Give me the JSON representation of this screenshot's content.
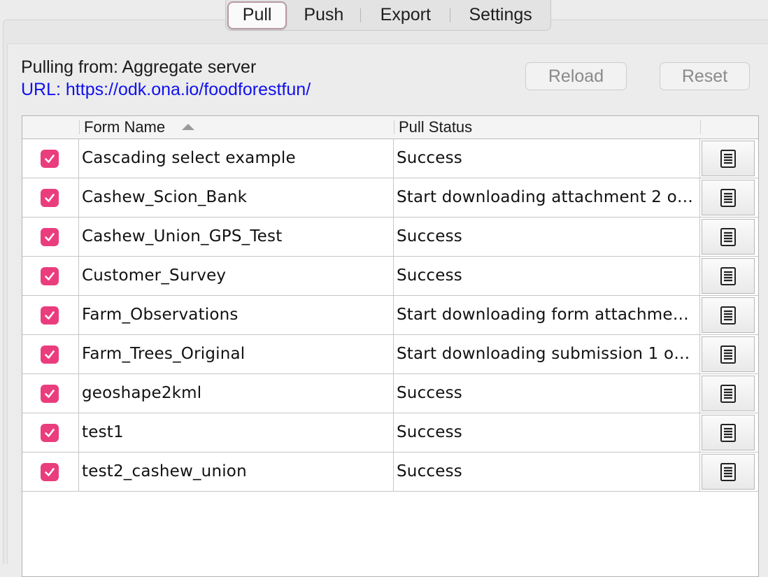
{
  "tabs": [
    {
      "label": "Pull",
      "active": true
    },
    {
      "label": "Push",
      "active": false
    },
    {
      "label": "Export",
      "active": false
    },
    {
      "label": "Settings",
      "active": false
    }
  ],
  "source": {
    "pulling_from": "Pulling from: Aggregate server",
    "url": "URL: https://odk.ona.io/foodforestfun/"
  },
  "buttons": {
    "reload": "Reload",
    "reset": "Reset"
  },
  "table": {
    "columns": {
      "form_name": "Form Name",
      "pull_status": "Pull Status"
    },
    "sort_icon": "sort-ascending-icon",
    "detail_icon": "document-details-icon",
    "rows": [
      {
        "checked": true,
        "name": "Cascading select example",
        "status": "Success"
      },
      {
        "checked": true,
        "name": "Cashew_Scion_Bank",
        "status": "Start downloading attachment 2 of ..."
      },
      {
        "checked": true,
        "name": "Cashew_Union_GPS_Test",
        "status": "Success"
      },
      {
        "checked": true,
        "name": "Customer_Survey",
        "status": "Success"
      },
      {
        "checked": true,
        "name": "Farm_Observations",
        "status": "Start downloading form attachment..."
      },
      {
        "checked": true,
        "name": "Farm_Trees_Original",
        "status": "Start downloading submission 1 of ..."
      },
      {
        "checked": true,
        "name": "geoshape2kml",
        "status": "Success"
      },
      {
        "checked": true,
        "name": "test1",
        "status": "Success"
      },
      {
        "checked": true,
        "name": "test2_cashew_union",
        "status": "Success"
      }
    ]
  },
  "colors": {
    "checkbox": "#ea3d7d",
    "url": "#1111ee",
    "disabled_text": "#8a8a8a"
  }
}
